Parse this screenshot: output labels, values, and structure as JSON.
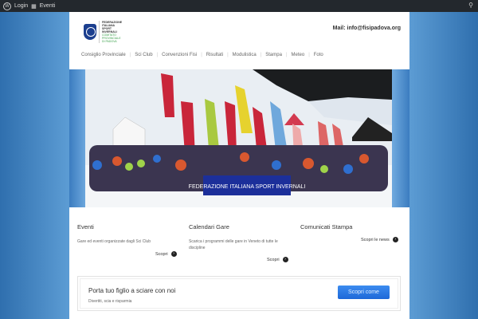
{
  "adminbar": {
    "login": "Login",
    "events": "Eventi"
  },
  "header": {
    "logo_text": [
      "FEDERAZIONE",
      "ITALIANA",
      "SPORT",
      "INVERNALI"
    ],
    "logo_sub": [
      "COMITATO",
      "PROVINCIALE",
      "DI PADOVA"
    ],
    "mail": "Mail: info@fisipadova.org"
  },
  "nav": [
    "Consiglio Provinciale",
    "Sci Club",
    "Convenzioni Fisi",
    "Risultati",
    "Modulistica",
    "Stampa",
    "Meteo",
    "Foto"
  ],
  "columns": [
    {
      "title": "Eventi",
      "text": "Gare ed eventi organizzate dagli Sci Club",
      "link": "Scopri"
    },
    {
      "title": "Calendari Gare",
      "text": "Scarica i programmi delle gare in Veneto di tutte le discipline",
      "link": "Scopri"
    },
    {
      "title": "Comunicati Stampa",
      "text": "",
      "link": "Scopri le news"
    }
  ],
  "cta": {
    "title": "Porta tuo figlio a sciare con noi",
    "subtitle": "Divertiti, scia e risparmia",
    "button": "Scopri come"
  },
  "photo_banner": "FEDERAZIONE ITALIANA SPORT INVERNALI"
}
